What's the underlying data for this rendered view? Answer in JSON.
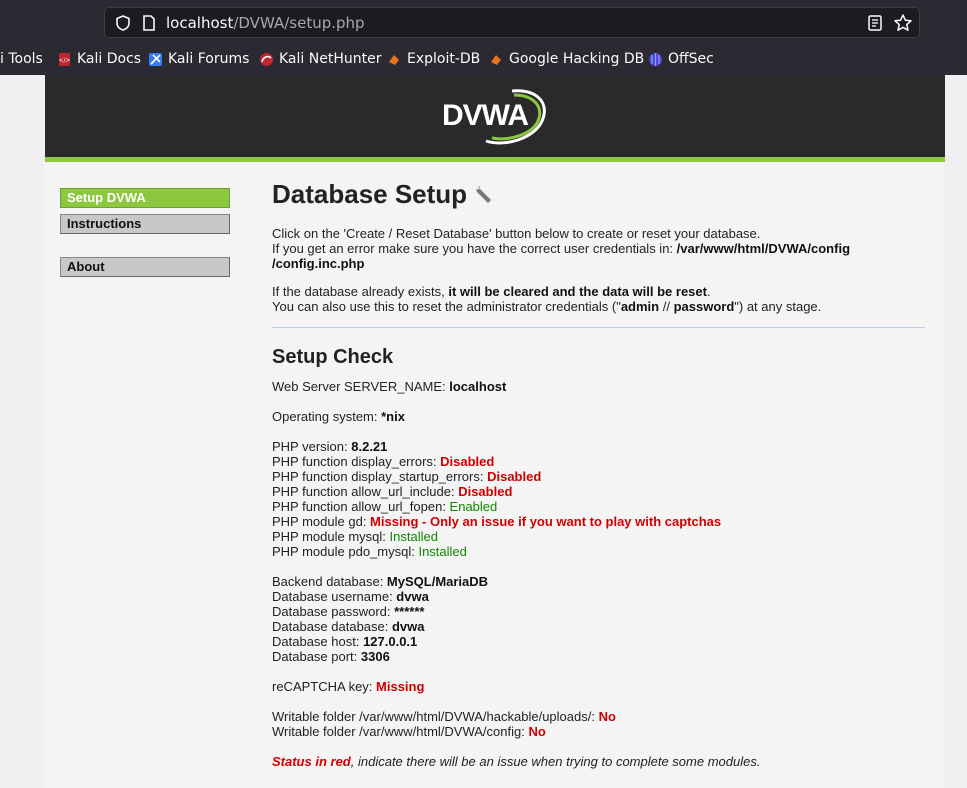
{
  "browser": {
    "url_host": "localhost",
    "url_path": "/DVWA/setup.php",
    "bookmarks": [
      {
        "label": "i Tools",
        "icon": "kali-tools-icon"
      },
      {
        "label": "Kali Docs",
        "icon": "kali-docs-icon"
      },
      {
        "label": "Kali Forums",
        "icon": "kali-forums-icon"
      },
      {
        "label": "Kali NetHunter",
        "icon": "kali-nethunter-icon"
      },
      {
        "label": "Exploit-DB",
        "icon": "exploit-db-icon"
      },
      {
        "label": "Google Hacking DB",
        "icon": "ghdb-icon"
      },
      {
        "label": "OffSec",
        "icon": "offsec-icon"
      }
    ]
  },
  "header": {
    "logo_text": "DVWA"
  },
  "menu": {
    "setup": "Setup DVWA",
    "instructions": "Instructions",
    "about": "About"
  },
  "main": {
    "title": "Database Setup",
    "intro_1": "Click on the 'Create / Reset Database' button below to create or reset your database.",
    "intro_2": "If you get an error make sure you have the correct user credentials in: ",
    "config_path_1": "/var/www/html/DVWA/config",
    "config_path_2": "/config.inc.php",
    "exists_1": "If the database already exists, ",
    "exists_bold": "it will be cleared and the data will be reset",
    "exists_2": ".",
    "reset_1": "You can also use this to reset the administrator credentials (\"",
    "reset_user": "admin",
    "reset_sep": " // ",
    "reset_pass": "password",
    "reset_2": "\") at any stage.",
    "check_title": "Setup Check",
    "server_name_label": "Web Server SERVER_NAME: ",
    "server_name": "localhost",
    "os_label": "Operating system: ",
    "os": "*nix",
    "php_version_label": "PHP version: ",
    "php_version": "8.2.21",
    "display_errors_label": "PHP function display_errors: ",
    "display_errors": "Disabled",
    "display_startup_errors_label": "PHP function display_startup_errors: ",
    "display_startup_errors": "Disabled",
    "allow_url_include_label": "PHP function allow_url_include: ",
    "allow_url_include": "Disabled",
    "allow_url_fopen_label": "PHP function allow_url_fopen: ",
    "allow_url_fopen": "Enabled",
    "gd_label": "PHP module gd: ",
    "gd": "Missing - Only an issue if you want to play with captchas",
    "mysql_label": "PHP module mysql: ",
    "mysql": "Installed",
    "pdo_mysql_label": "PHP module pdo_mysql: ",
    "pdo_mysql": "Installed",
    "backend_label": "Backend database: ",
    "backend": "MySQL/MariaDB",
    "db_user_label": "Database username: ",
    "db_user": "dvwa",
    "db_pass_label": "Database password: ",
    "db_pass": "******",
    "db_name_label": "Database database: ",
    "db_name": "dvwa",
    "db_host_label": "Database host: ",
    "db_host": "127.0.0.1",
    "db_port_label": "Database port: ",
    "db_port": "3306",
    "recaptcha_label": "reCAPTCHA key: ",
    "recaptcha": "Missing",
    "uploads_label": "Writable folder /var/www/html/DVWA/hackable/uploads/: ",
    "uploads": "No",
    "config_label": "Writable folder /var/www/html/DVWA/config: ",
    "config": "No",
    "status_red": "Status in red",
    "status_rest": ", indicate there will be an issue when trying to complete some modules."
  },
  "colors": {
    "accent": "#8dc63f",
    "error": "#d10000",
    "ok": "#118800",
    "header_bg": "#2a2a2a"
  }
}
